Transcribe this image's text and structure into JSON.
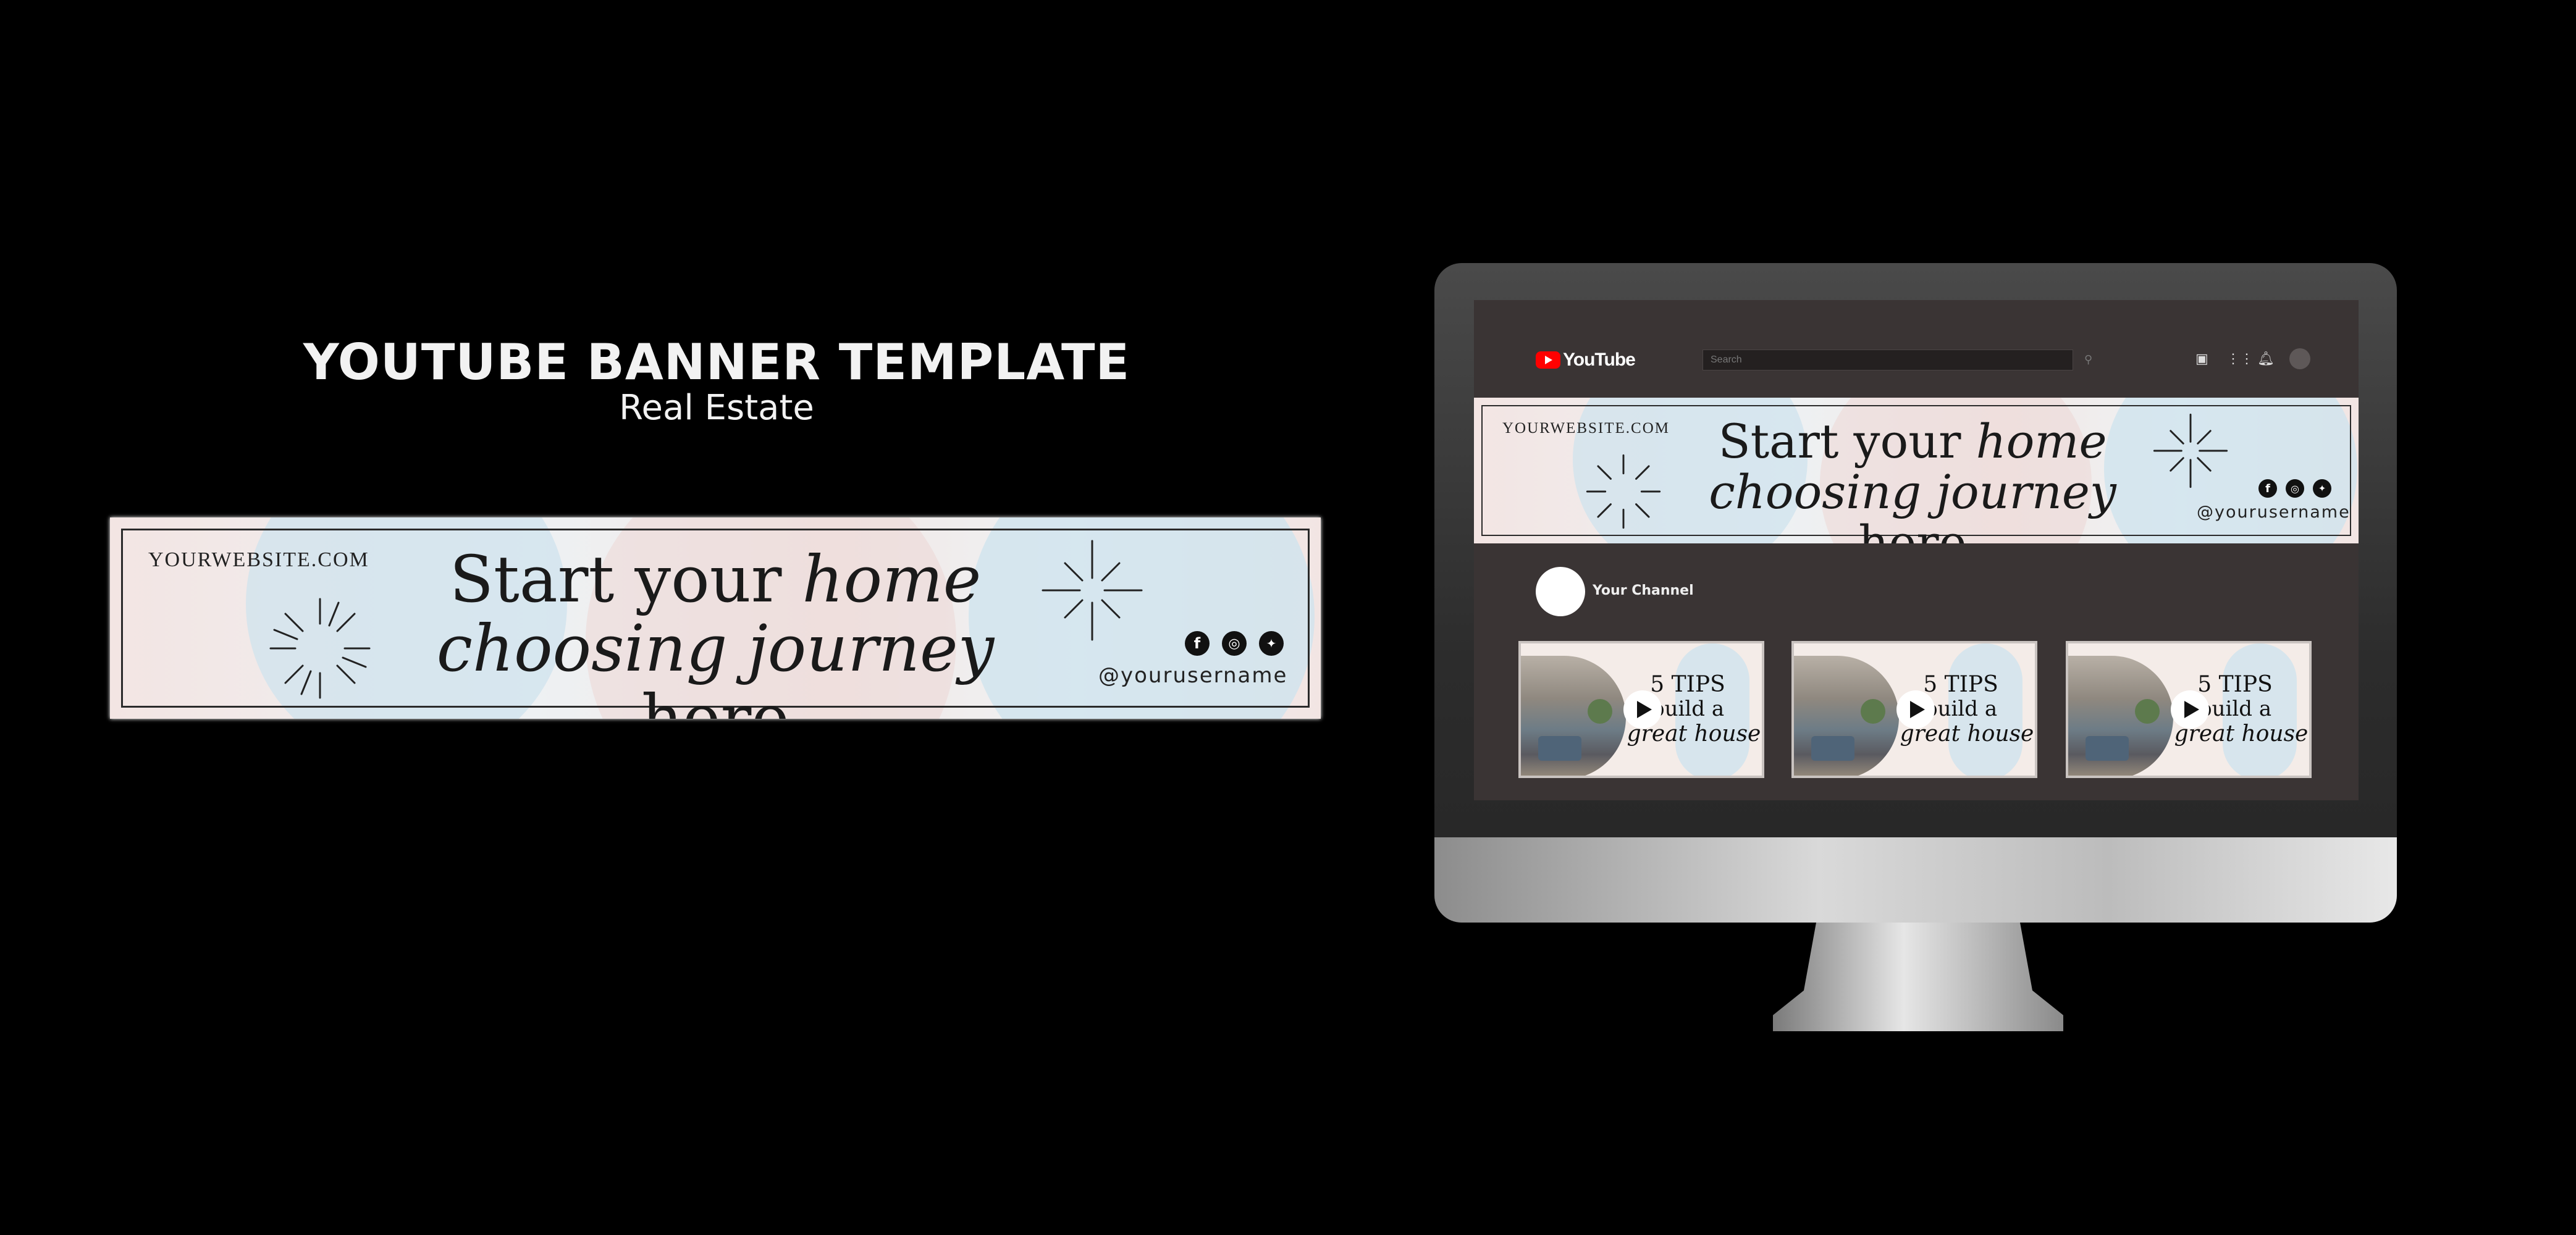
{
  "page": {
    "title": "YOUTUBE BANNER TEMPLATE",
    "subtitle": "Real Estate"
  },
  "banner": {
    "website": "YOURWEBSITE.COM",
    "headline_line1_regular": "Start your",
    "headline_line1_italic": "home",
    "headline_line2_italic": "choosing journey",
    "headline_line2_regular": "here",
    "username": "@yourusername",
    "socials": [
      "facebook-icon",
      "instagram-icon",
      "twitter-icon"
    ],
    "colors": {
      "blush": "#f3e5e3",
      "sky": "#cfe3ee",
      "ink": "#1a1a1a"
    }
  },
  "youtube": {
    "logo_text": "YouTube",
    "search_placeholder": "Search",
    "channel_name": "Your Channel",
    "brand_color": "#ff0000"
  },
  "thumbnails": [
    {
      "line1": "5 TIPS",
      "line2": "build a",
      "line3": "great house"
    },
    {
      "line1": "5 TIPS",
      "line2": "build a",
      "line3": "great house"
    },
    {
      "line1": "5 TIPS",
      "line2": "build a",
      "line3": "great house"
    }
  ]
}
